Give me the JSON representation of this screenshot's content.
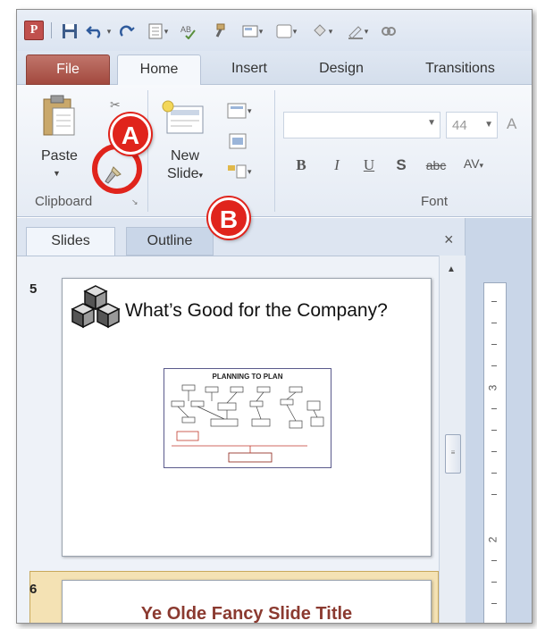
{
  "ribbon_tabs": {
    "file": "File",
    "home": "Home",
    "insert": "Insert",
    "design": "Design",
    "transitions": "Transitions"
  },
  "qat": {
    "app_logo": "P",
    "icons": [
      "save-icon",
      "undo-icon",
      "redo-icon",
      "slide-layout-icon",
      "spelling-icon",
      "format-painter-icon",
      "new-slide-icon",
      "shape-icon",
      "fill-icon",
      "outline-icon",
      "link-icon"
    ]
  },
  "clipboard": {
    "paste_label": "Paste",
    "group_label": "Clipboard",
    "brush_tooltip": "Format Painter"
  },
  "slides_group": {
    "new_slide_line1": "New",
    "new_slide_line2": "Slide"
  },
  "font_group": {
    "font_name": "",
    "font_size": "44",
    "group_label": "Font",
    "bold": "B",
    "italic": "I",
    "underline": "U",
    "shadow": "S",
    "strike": "abc",
    "spacing": "AV"
  },
  "panel": {
    "tab_slides": "Slides",
    "tab_outline": "Outline",
    "close_glyph": "×"
  },
  "slides": [
    {
      "number": "5",
      "title": "What’s Good for the Company?",
      "diagram_title": "PLANNING TO PLAN"
    },
    {
      "number": "6",
      "title": "Ye Olde Fancy Slide Title"
    }
  ],
  "ruler": {
    "labels": [
      "3",
      "2"
    ]
  },
  "callouts": {
    "a": "A",
    "b": "B"
  },
  "colors": {
    "callout_red": "#e0241c",
    "file_tab": "#a2493e",
    "slide6_title": "#8b3a30",
    "selected_slide_bg": "#f4e2b4"
  }
}
